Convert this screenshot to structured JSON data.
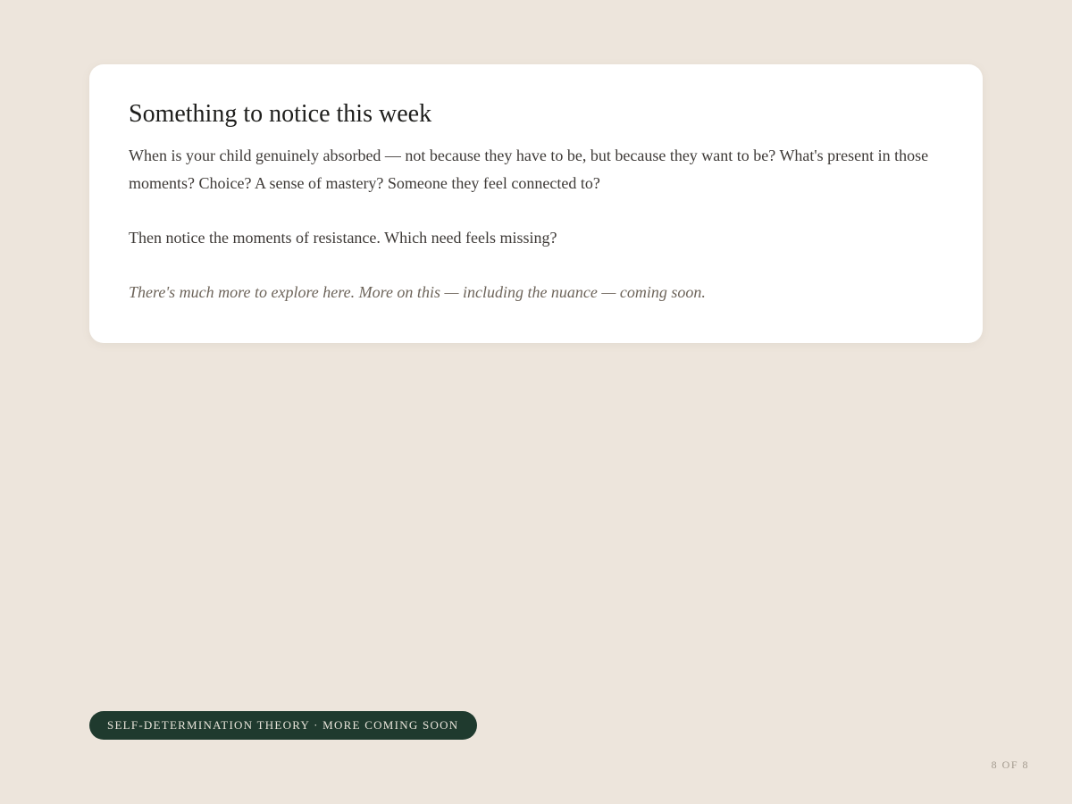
{
  "card": {
    "title": "Something to notice this week",
    "paragraph_1": "When is your child genuinely absorbed — not because they have to be, but because they want to be? What's present in those moments? Choice? A sense of mastery? Someone they feel connected to?",
    "paragraph_2": "Then notice the moments of resistance. Which need feels missing?",
    "note": "There's much more to explore here. More on this — including the nuance — coming soon."
  },
  "footer": {
    "tag": "SELF-DETERMINATION THEORY · MORE COMING SOON",
    "page_counter": "8 OF 8"
  },
  "colors": {
    "background": "#ede5dc",
    "card": "#ffffff",
    "pill": "#1f3a2e",
    "pill_text": "#e8e4da"
  }
}
